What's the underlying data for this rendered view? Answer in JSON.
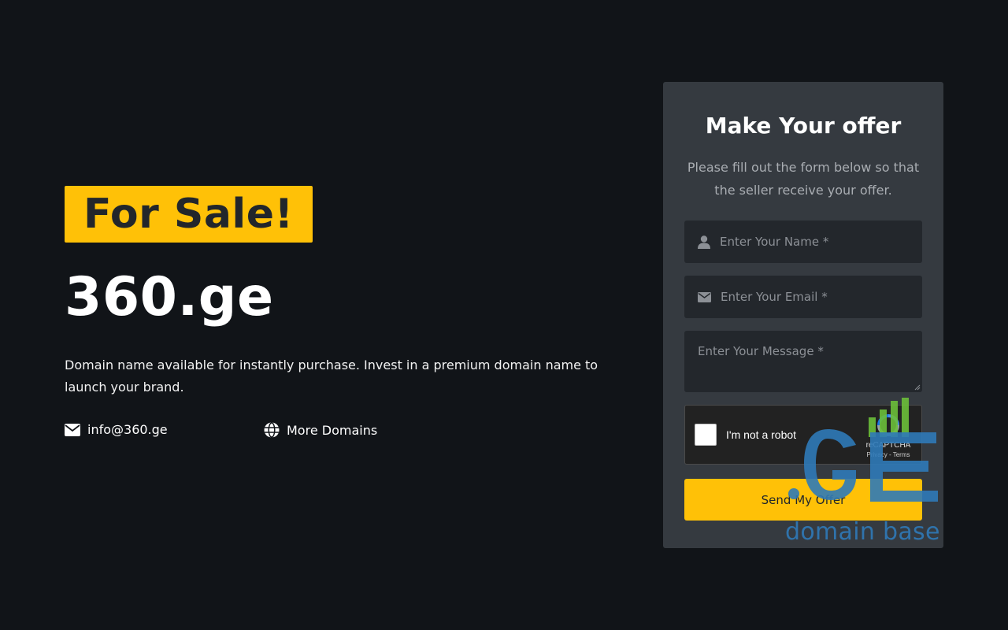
{
  "hero": {
    "badge": "For Sale!",
    "domain": "360.ge",
    "description": "Domain name available for instantly purchase. Invest in a premium domain name to launch your brand.",
    "email_link": "info@360.ge",
    "more_domains_link": "More Domains"
  },
  "offer_form": {
    "title": "Make Your offer",
    "subtitle": "Please fill out the form below so that the seller receive your offer.",
    "name_placeholder": "Enter Your Name *",
    "email_placeholder": "Enter Your Email *",
    "message_placeholder": "Enter Your Message *",
    "captcha_label": "I'm not a robot",
    "captcha_brand": "reCAPTCHA",
    "captcha_links": "Privacy - Terms",
    "submit_label": "Send My Offer"
  },
  "watermark": {
    "text": "domain base"
  },
  "colors": {
    "background": "#111418",
    "accent": "#ffc107",
    "card": "#353a40",
    "input": "#23272c",
    "watermark_blue": "#2f7ab8",
    "watermark_green": "#6cbf3a"
  }
}
